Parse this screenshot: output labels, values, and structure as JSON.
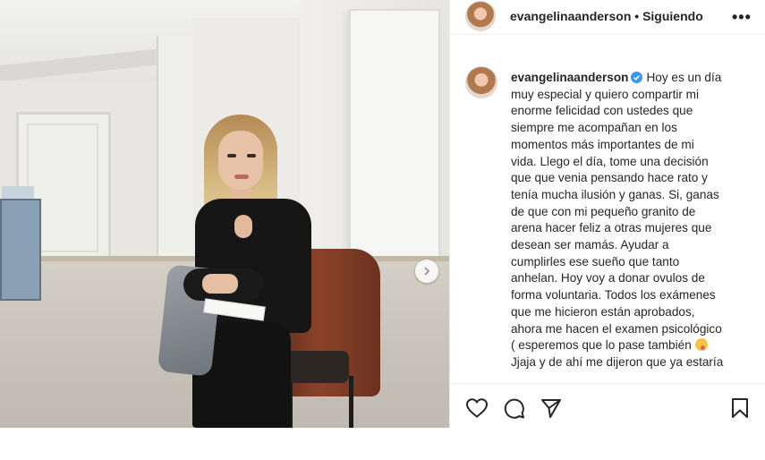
{
  "post": {
    "username": "evangelinaanderson",
    "separator": "•",
    "follow_status": "Siguiendo",
    "more_label": "•••",
    "caption_lines": [
      "Hoy es un día",
      "muy especial y quiero compartir mi",
      "enorme felicidad con ustedes que",
      "siempre me acompañan en los",
      "momentos más importantes de mi",
      "vida. Llego el día, tome una decisión",
      "que que venia pensando hace rato y",
      "tenía mucha ilusión y ganas. Si, ganas",
      "de que con mi pequeño granito de",
      "arena hacer feliz a otras mujeres que",
      "desean ser mamás. Ayudar a",
      "cumplirles ese sueño que tanto",
      "anhelan. Hoy voy a donar ovulos de",
      "forma voluntaria. Todos los exámenes",
      "que me hicieron están aprobados,",
      "ahora me hacen el examen psicológico",
      "( esperemos que lo pase también",
      "Jjaja y de ahí me dijeron que ya estaría"
    ]
  },
  "icons": {
    "like": "heart-icon",
    "comment": "comment-icon",
    "share": "paper-plane-icon",
    "save": "bookmark-icon",
    "verified": "verified-badge-icon",
    "next": "chevron-right-icon",
    "emoji": "tongue-out-emoji"
  },
  "colors": {
    "text": "#262626",
    "verified": "#3897f0",
    "divider": "#efefef"
  }
}
